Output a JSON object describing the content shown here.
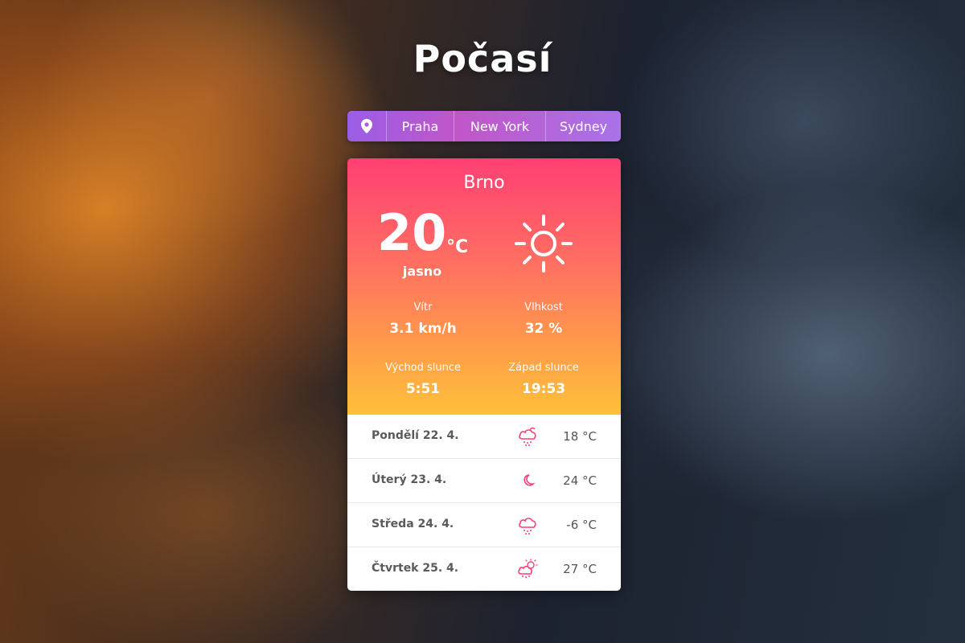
{
  "app": {
    "title": "Počasí"
  },
  "city_nav": {
    "location_icon": "map-pin-icon",
    "cities": [
      "Praha",
      "New York",
      "Sydney"
    ]
  },
  "current": {
    "city": "Brno",
    "temperature": "20",
    "unit": "°C",
    "description": "jasno",
    "icon": "sun-icon",
    "wind": {
      "label": "Vítr",
      "value": "3.1 km/h"
    },
    "humidity": {
      "label": "Vlhkost",
      "value": "32 %"
    },
    "sunrise": {
      "label": "Východ slunce",
      "value": "5:51"
    },
    "sunset": {
      "label": "Západ slunce",
      "value": "19:53"
    }
  },
  "forecast": [
    {
      "day": "Pondělí 22. 4.",
      "icon": "cloud-rain-night-icon",
      "temp": "18 °C"
    },
    {
      "day": "Úterý 23. 4.",
      "icon": "moon-icon",
      "temp": "24 °C"
    },
    {
      "day": "Středa 24. 4.",
      "icon": "cloud-rain-icon",
      "temp": "-6 °C"
    },
    {
      "day": "Čtvrtek 25. 4.",
      "icon": "sun-cloud-rain-icon",
      "temp": "27 °C"
    }
  ],
  "colors": {
    "header_gradient_top": "#ff3f73",
    "header_gradient_bottom": "#ffc03a",
    "nav_gradient": "#c056c8",
    "forecast_icon": "#ff3f73"
  }
}
